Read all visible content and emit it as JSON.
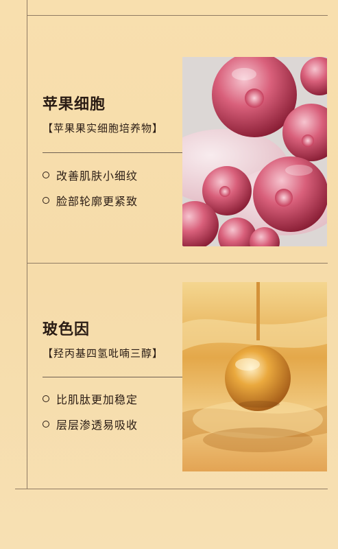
{
  "sections": [
    {
      "title": "苹果细胞",
      "subtitle": "【苹果果实细胞培养物】",
      "benefits": [
        "改善肌肤小细纹",
        "脸部轮廓更紧致"
      ],
      "image": "pink-cell-spheres"
    },
    {
      "title": "玻色因",
      "subtitle": "【羟丙基四氢吡喃三醇】",
      "benefits": [
        "比肌肽更加稳定",
        "层层渗透易吸收"
      ],
      "image": "golden-serum-drop"
    }
  ],
  "colors": {
    "background": "#f7deac",
    "line": "#8f7a63",
    "text": "#2a1c14",
    "pink_cells": "#c4415d",
    "gold_serum": "#e0a443"
  }
}
